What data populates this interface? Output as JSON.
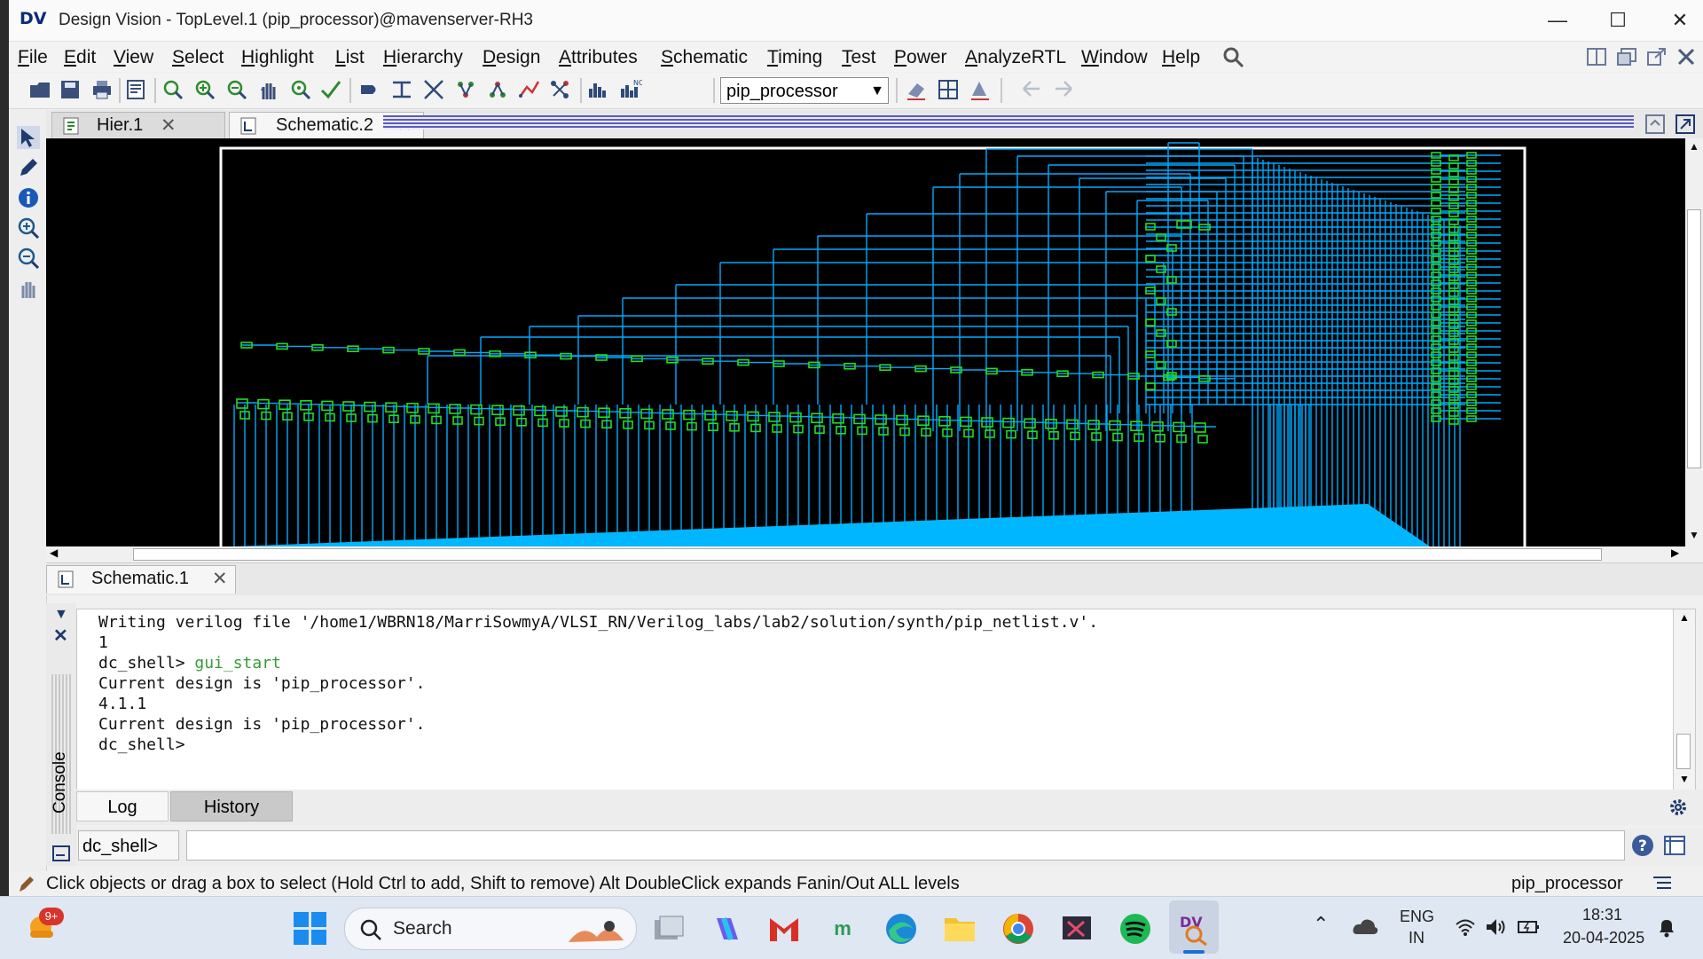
{
  "window": {
    "app_icon": "DV",
    "title": "Design Vision - TopLevel.1 (pip_processor)@mavenserver-RH3"
  },
  "menu": [
    "File",
    "Edit",
    "View",
    "Select",
    "Highlight",
    "List",
    "Hierarchy",
    "Design",
    "Attributes",
    "Schematic",
    "Timing",
    "Test",
    "Power",
    "AnalyzeRTL",
    "Window",
    "Help"
  ],
  "toolbar": {
    "design_select": "pip_processor"
  },
  "tabs": {
    "top": [
      {
        "label": "Hier.1",
        "active": false
      },
      {
        "label": "Schematic.2",
        "active": true
      }
    ],
    "bottom": [
      {
        "label": "Schematic.1"
      }
    ]
  },
  "console": {
    "side_label": "Console",
    "lines": [
      "Writing verilog file '/home1/WBRN18/MarriSowmyA/VLSI_RN/Verilog_labs/lab2/solution/synth/pip_netlist.v'.",
      "1",
      "dc_shell> ",
      "Current design is 'pip_processor'.",
      "4.1.1",
      "Current design is 'pip_processor'.",
      "dc_shell>"
    ],
    "command_text": "gui_start",
    "command_color": "#3a9a3a",
    "tabs": [
      "Log",
      "History"
    ],
    "prompt_label": "dc_shell>",
    "input_value": ""
  },
  "status": {
    "hint": "Click objects or drag a box to select (Hold Ctrl to add, Shift to remove) Alt DoubleClick expands Fanin/Out ALL levels",
    "design": "pip_processor"
  },
  "taskbar": {
    "search_label": "Search",
    "weather_badge": "9+",
    "lang_top": "ENG",
    "lang_bottom": "IN",
    "time": "18:31",
    "date": "20-04-2025"
  },
  "colors": {
    "canvas_bg": "#000000",
    "wire": "#00aaff",
    "cell": "#22dd22",
    "frame": "#ffffff"
  }
}
